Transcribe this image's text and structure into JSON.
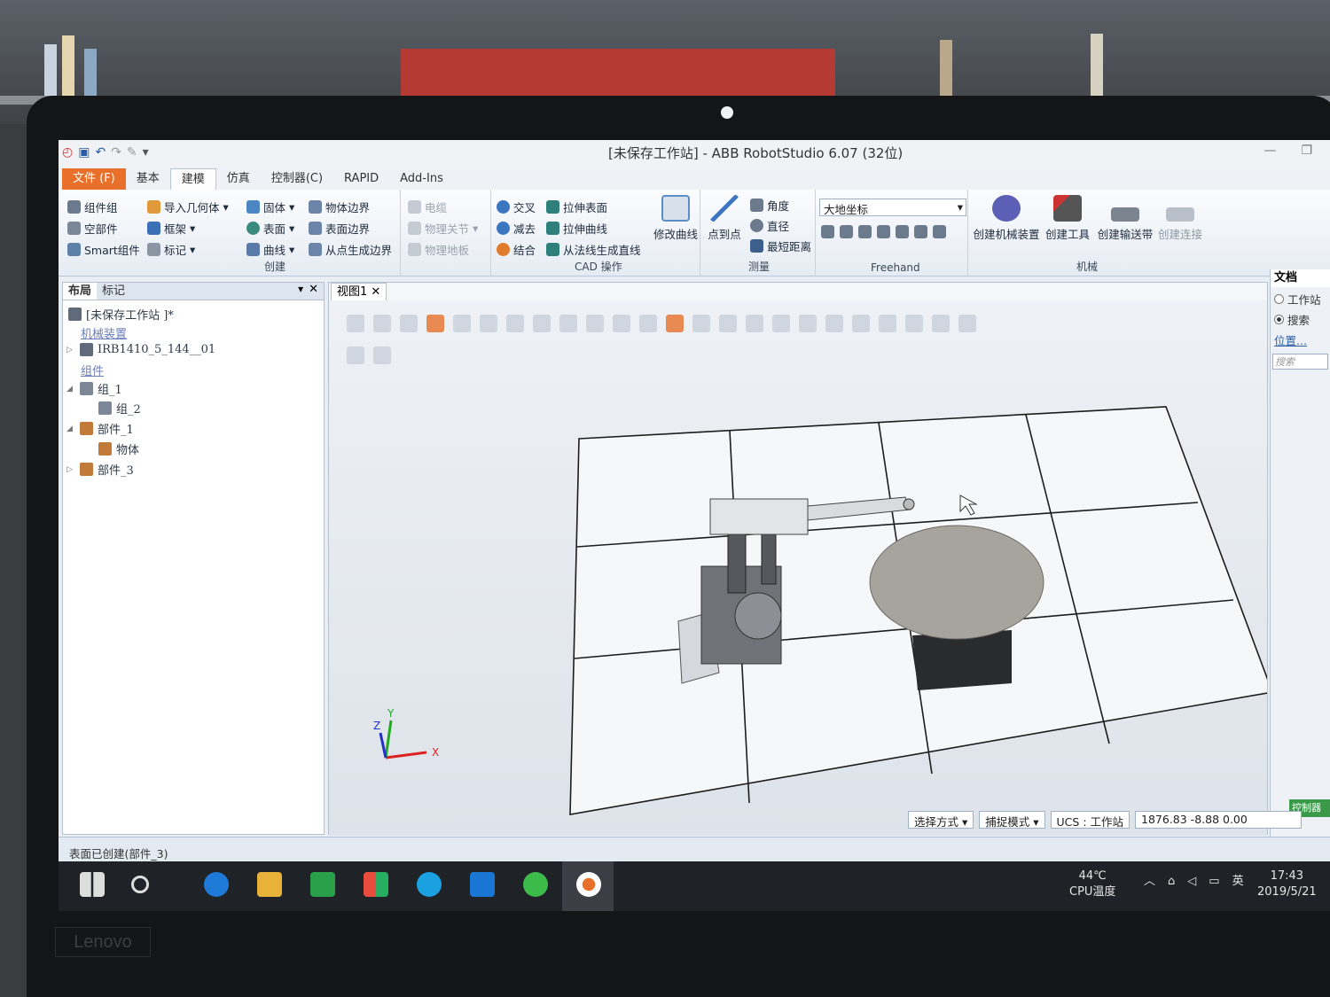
{
  "window": {
    "title": "[未保存工作站] - ABB RobotStudio 6.07 (32位)"
  },
  "menu": {
    "tabs": [
      "文件 (F)",
      "基本",
      "建模",
      "仿真",
      "控制器(C)",
      "RAPID",
      "Add-Ins"
    ],
    "active": "建模"
  },
  "ribbon": {
    "create": {
      "label": "创建",
      "items": [
        "组件组",
        "空部件",
        "Smart组件",
        "导入几何体",
        "框架",
        "标记",
        "固体",
        "表面",
        "曲线",
        "物体边界",
        "表面边界",
        "从点生成边界"
      ]
    },
    "physics": {
      "items": [
        "电缆",
        "物理关节",
        "物理地板"
      ]
    },
    "cad": {
      "label": "CAD 操作",
      "items": [
        "交叉",
        "减去",
        "结合",
        "拉伸表面",
        "拉伸曲线",
        "从法线生成直线",
        "修改曲线"
      ]
    },
    "measure": {
      "label": "测量",
      "items": [
        "点到点",
        "角度",
        "直径",
        "最短距离"
      ]
    },
    "freehand": {
      "label": "Freehand",
      "combo": "大地坐标"
    },
    "mechanism": {
      "label": "机械",
      "items": [
        "创建机械装置",
        "创建工具",
        "创建输送带",
        "创建连接"
      ]
    }
  },
  "left_panel": {
    "tabs": [
      "布局",
      "标记"
    ],
    "tree": [
      {
        "label": "[未保存工作站 ]*",
        "kind": "root"
      },
      {
        "label": "机械装置",
        "kind": "link"
      },
      {
        "label": "IRB1410_5_144__01",
        "kind": "node"
      },
      {
        "label": "组件",
        "kind": "link"
      },
      {
        "label": "组_1",
        "kind": "node"
      },
      {
        "label": "组_2",
        "kind": "node"
      },
      {
        "label": "部件_1",
        "kind": "node"
      },
      {
        "label": "物体",
        "kind": "node"
      },
      {
        "label": "部件_3",
        "kind": "node"
      }
    ]
  },
  "viewport": {
    "tab": "视图1",
    "axes": {
      "x": "X",
      "y": "Y",
      "z": "Z"
    }
  },
  "right_panel": {
    "title": "文档",
    "options": [
      "工作站",
      "搜索"
    ],
    "selected": "搜索",
    "link": "位置...",
    "search_placeholder": "搜索",
    "controller_tab": "控制器"
  },
  "status": {
    "message": "表面已创建(部件_3)",
    "select_mode": "选择方式",
    "snap_mode": "捕捉模式",
    "ucs": "UCS : 工作站",
    "coords": "1876.83   -8.88   0.00"
  },
  "taskbar": {
    "temperature": "44℃",
    "temp_label": "CPU温度",
    "ime": "英",
    "time": "17:43",
    "date": "2019/5/21"
  },
  "brand": "Lenovo"
}
